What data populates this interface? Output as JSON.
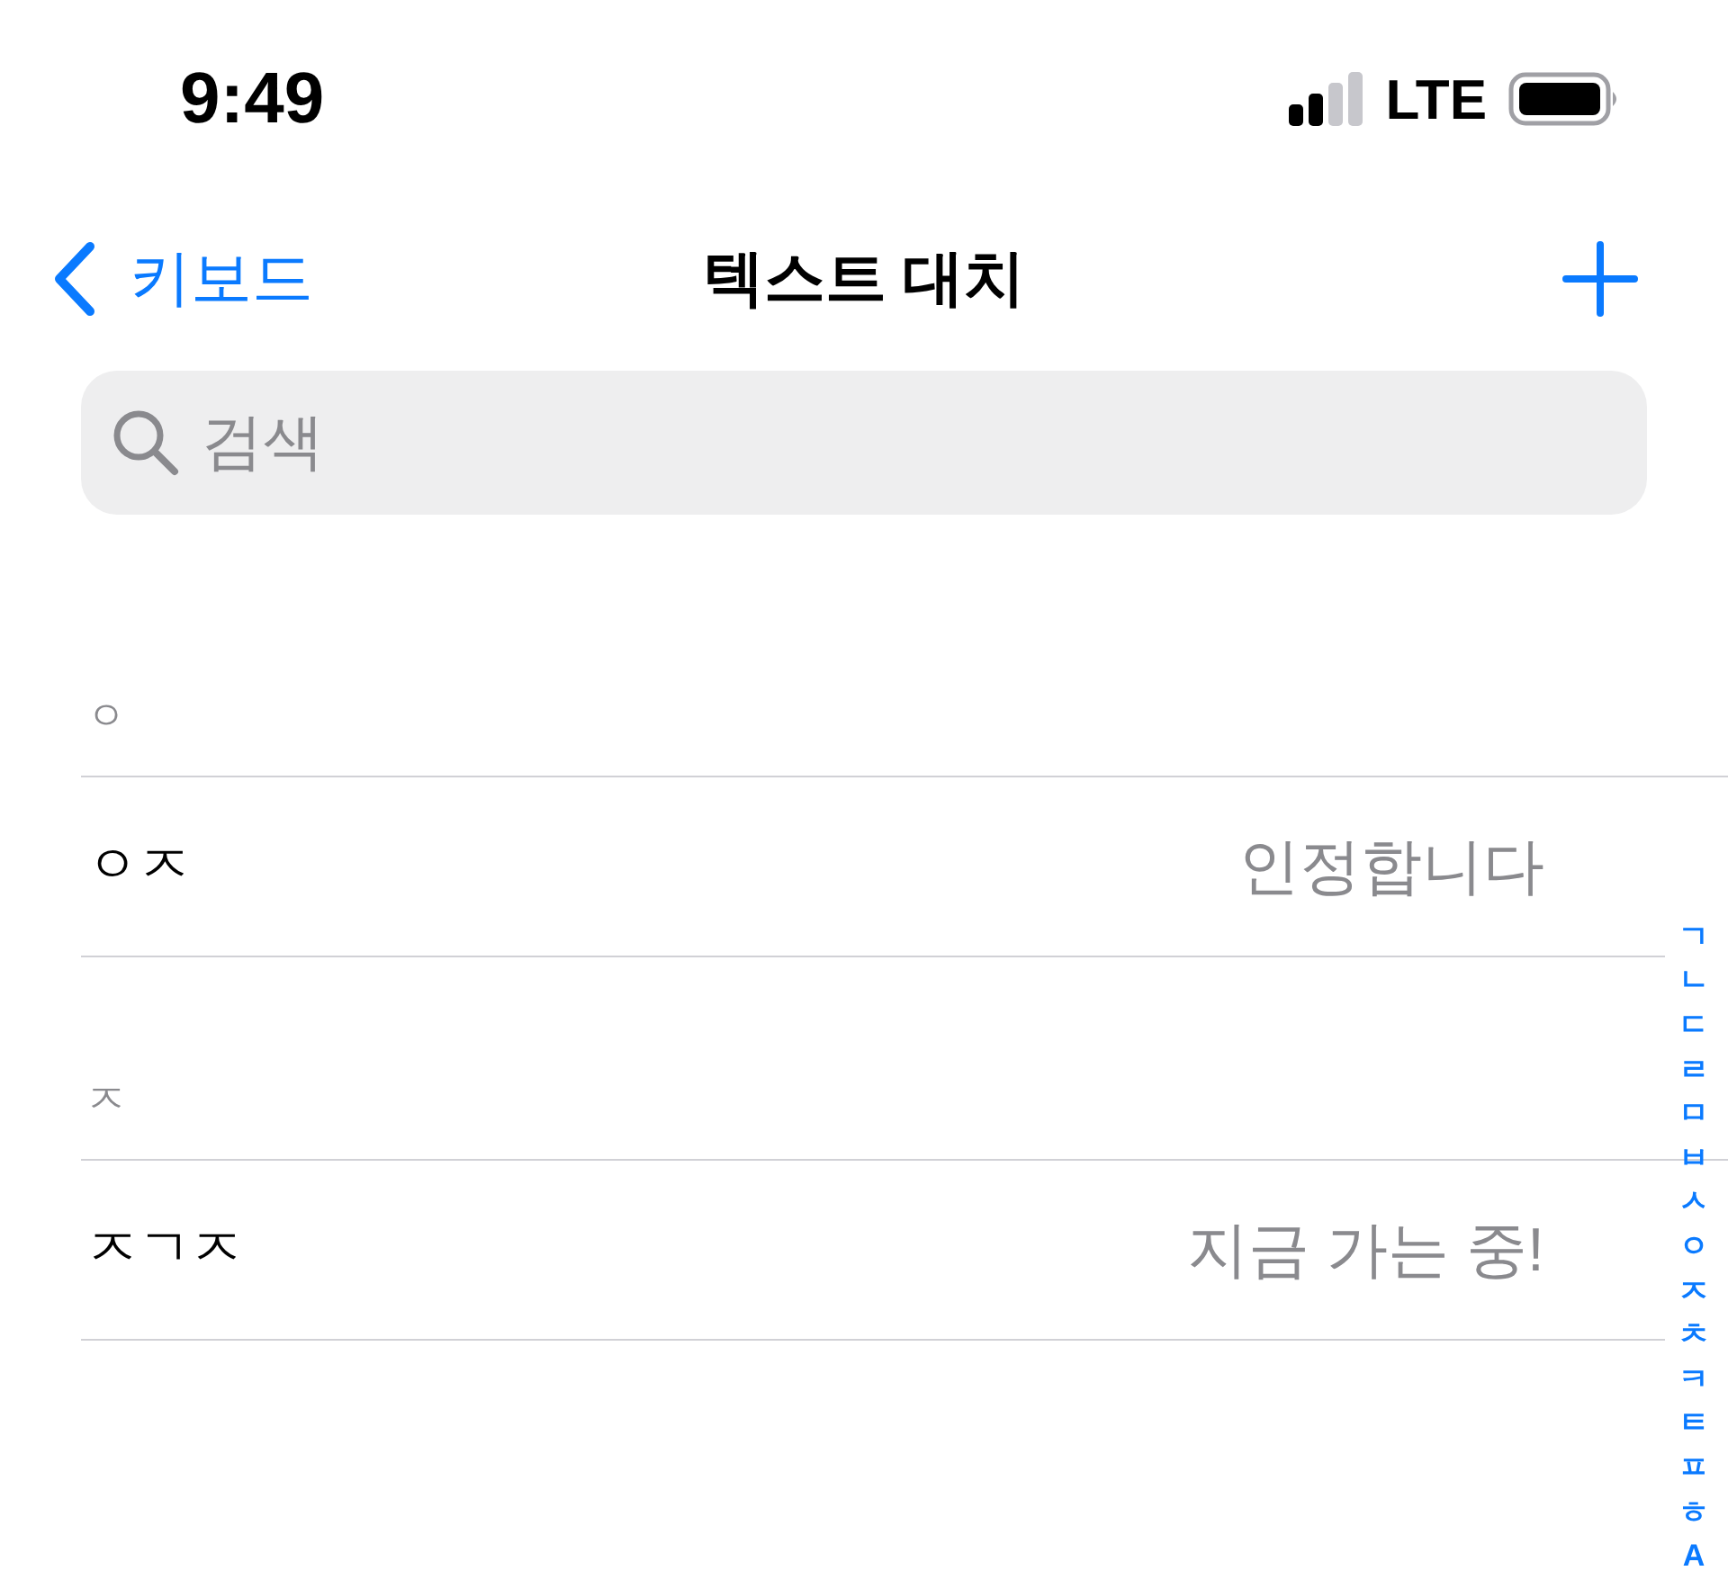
{
  "status_bar": {
    "time": "9:49",
    "network": "LTE"
  },
  "nav_bar": {
    "back_label": "키보드",
    "title": "텍스트 대치"
  },
  "search": {
    "placeholder": "검색"
  },
  "sections": [
    {
      "header": "ㅇ",
      "rows": [
        {
          "shortcut": "ㅇㅈ",
          "phrase": "인정합니다"
        }
      ]
    },
    {
      "header": "ㅈ",
      "rows": [
        {
          "shortcut": "ㅈㄱㅈ",
          "phrase": "지금 가는 중!"
        }
      ]
    }
  ],
  "index": [
    "ㄱ",
    "ㄴ",
    "ㄷ",
    "ㄹ",
    "ㅁ",
    "ㅂ",
    "ㅅ",
    "ㅇ",
    "ㅈ",
    "ㅊ",
    "ㅋ",
    "ㅌ",
    "ㅍ",
    "ㅎ",
    "A"
  ]
}
